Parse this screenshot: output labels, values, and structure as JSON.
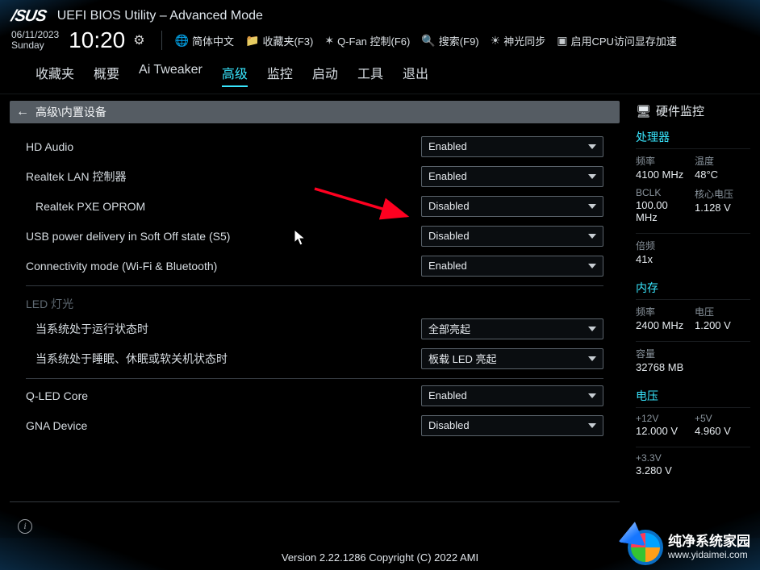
{
  "header": {
    "brand": "/SUS",
    "title": "UEFI BIOS Utility – Advanced Mode"
  },
  "clock": {
    "date": "06/11/2023",
    "dow": "Sunday",
    "time": "10:20"
  },
  "toolbar": {
    "lang": {
      "icon": "globe-icon",
      "label": "简体中文"
    },
    "fav": {
      "icon": "folder-icon",
      "label": "收藏夹(F3)"
    },
    "qfan": {
      "icon": "fan-icon",
      "label": "Q-Fan 控制(F6)"
    },
    "search": {
      "icon": "search-icon",
      "label": "搜索(F9)"
    },
    "sync": {
      "icon": "sun-icon",
      "label": "神光同步"
    },
    "cpu": {
      "icon": "chip-icon",
      "label": "启用CPU访问显存加速"
    }
  },
  "tabs": [
    {
      "id": "fav",
      "label": "收藏夹"
    },
    {
      "id": "summary",
      "label": "概要"
    },
    {
      "id": "aitweaker",
      "label": "Ai Tweaker"
    },
    {
      "id": "advanced",
      "label": "高级",
      "active": true
    },
    {
      "id": "monitor",
      "label": "监控"
    },
    {
      "id": "boot",
      "label": "启动"
    },
    {
      "id": "tool",
      "label": "工具"
    },
    {
      "id": "exit",
      "label": "退出"
    }
  ],
  "crumb": "高级\\内置设备",
  "settings": [
    {
      "id": "hd-audio",
      "label": "HD Audio",
      "value": "Enabled"
    },
    {
      "id": "realtek-lan",
      "label": "Realtek LAN 控制器",
      "value": "Enabled"
    },
    {
      "id": "pxe-oprom",
      "label": "Realtek PXE OPROM",
      "value": "Disabled",
      "indent": true
    },
    {
      "id": "usb-s5",
      "label": "USB power delivery in Soft Off state (S5)",
      "value": "Disabled",
      "highlight": true
    },
    {
      "id": "connectivity",
      "label": "Connectivity mode (Wi-Fi & Bluetooth)",
      "value": "Enabled"
    }
  ],
  "led_group": {
    "header": "LED 灯光",
    "items": [
      {
        "id": "led-run",
        "label": "当系统处于运行状态时",
        "value": "全部亮起"
      },
      {
        "id": "led-sleep",
        "label": "当系统处于睡眠、休眠或软关机状态时",
        "value": "板载 LED 亮起"
      }
    ]
  },
  "settings2": [
    {
      "id": "qled-core",
      "label": "Q-LED Core",
      "value": "Enabled"
    },
    {
      "id": "gna",
      "label": "GNA Device",
      "value": "Disabled"
    }
  ],
  "sidebar": {
    "title": "硬件监控",
    "cpu": {
      "header": "处理器",
      "freq_lbl": "频率",
      "freq": "4100 MHz",
      "temp_lbl": "温度",
      "temp": "48°C",
      "bclk_lbl": "BCLK",
      "bclk": "100.00 MHz",
      "vcore_lbl": "核心电压",
      "vcore": "1.128 V",
      "ratio_lbl": "倍频",
      "ratio": "41x"
    },
    "mem": {
      "header": "内存",
      "freq_lbl": "频率",
      "freq": "2400 MHz",
      "volt_lbl": "电压",
      "volt": "1.200 V",
      "cap_lbl": "容量",
      "cap": "32768 MB"
    },
    "volt": {
      "header": "电压",
      "p12_lbl": "+12V",
      "p12": "12.000 V",
      "p5_lbl": "+5V",
      "p5": "4.960 V",
      "p33_lbl": "+3.3V",
      "p33": "3.280 V"
    }
  },
  "footer": "Version 2.22.1286 Copyright (C) 2022 AMI",
  "watermark": {
    "cn": "纯净系统家园",
    "url": "www.yidaimei.com"
  }
}
